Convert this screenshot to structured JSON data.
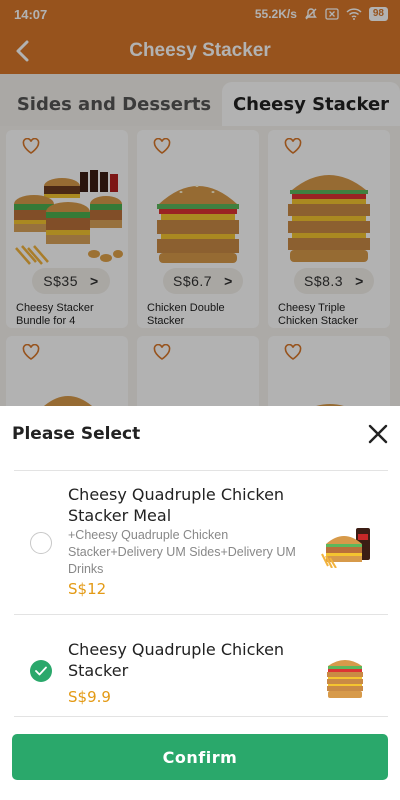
{
  "status_bar": {
    "time": "14:07",
    "network_speed": "55.2K/s",
    "battery": "98",
    "icons": [
      "mute-icon",
      "no-sim-icon",
      "wifi-icon",
      "battery-icon"
    ]
  },
  "header": {
    "title": "Cheesy Stacker",
    "back_icon": "chevron-left-icon"
  },
  "tabs": [
    {
      "label": "Sides and Desserts",
      "active": false
    },
    {
      "label": "Cheesy Stacker",
      "active": true
    }
  ],
  "products": [
    {
      "name": "Cheesy Stacker Bundle for 4",
      "price": "S$35",
      "image": "burger-bundle-image"
    },
    {
      "name": "Chicken Double Stacker",
      "price": "S$6.7",
      "image": "double-burger-image"
    },
    {
      "name": "Cheesy Triple Chicken Stacker",
      "price": "S$8.3",
      "image": "triple-burger-image"
    },
    {
      "name": "",
      "price": "",
      "image": "burger-image"
    },
    {
      "name": "",
      "price": "",
      "image": "burger-image"
    },
    {
      "name": "",
      "price": "",
      "image": "burger-image"
    }
  ],
  "sheet": {
    "title": "Please Select",
    "options": [
      {
        "name": "Cheesy Quadruple Chicken Stacker Meal",
        "description": "+Cheesy Quadruple Chicken Stacker+Delivery UM Sides+Delivery UM Drinks",
        "price": "S$12",
        "selected": false,
        "image": "meal-image"
      },
      {
        "name": "Cheesy Quadruple Chicken Stacker",
        "description": "",
        "price": "S$9.9",
        "selected": true,
        "image": "quadruple-burger-image"
      }
    ],
    "confirm_label": "Confirm"
  },
  "colors": {
    "brand": "#d8782a",
    "accent_green": "#2aa86b",
    "price": "#e39a15"
  }
}
